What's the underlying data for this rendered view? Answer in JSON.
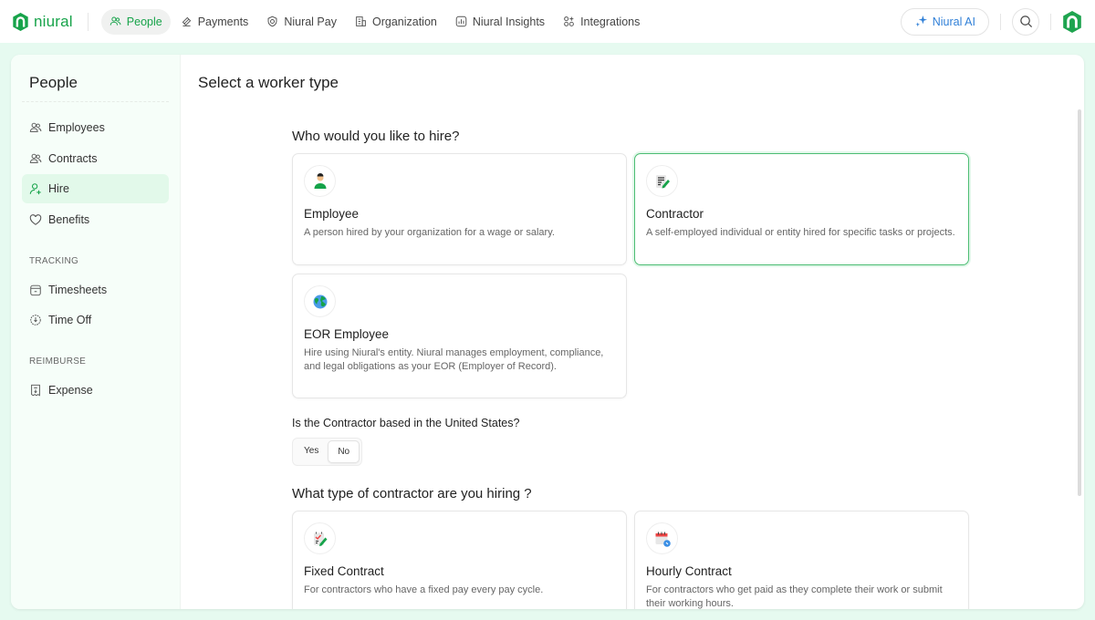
{
  "brand": {
    "name": "niural",
    "color": "#17a34a"
  },
  "nav": {
    "items": [
      {
        "label": "People",
        "icon": "users-icon",
        "active": true
      },
      {
        "label": "Payments",
        "icon": "payments-icon",
        "active": false
      },
      {
        "label": "Niural Pay",
        "icon": "shield-dollar-icon",
        "active": false
      },
      {
        "label": "Organization",
        "icon": "building-icon",
        "active": false
      },
      {
        "label": "Niural Insights",
        "icon": "chart-icon",
        "active": false
      },
      {
        "label": "Integrations",
        "icon": "apps-icon",
        "active": false
      }
    ],
    "ai_button": "Niural AI",
    "search_icon": "search-icon"
  },
  "sidebar": {
    "title": "People",
    "items": [
      {
        "label": "Employees",
        "icon": "users-icon",
        "active": false
      },
      {
        "label": "Contracts",
        "icon": "users-icon",
        "active": false
      },
      {
        "label": "Hire",
        "icon": "user-plus-icon",
        "active": true
      },
      {
        "label": "Benefits",
        "icon": "heart-icon",
        "active": false
      }
    ],
    "sections": [
      {
        "title": "TRACKING",
        "items": [
          {
            "label": "Timesheets",
            "icon": "calendar-icon"
          },
          {
            "label": "Time Off",
            "icon": "clock-icon"
          }
        ]
      },
      {
        "title": "REIMBURSE",
        "items": [
          {
            "label": "Expense",
            "icon": "receipt-icon"
          }
        ]
      }
    ]
  },
  "main": {
    "title": "Select a worker type",
    "question1": "Who would you like to hire?",
    "worker_types": [
      {
        "title": "Employee",
        "desc": "A person hired by your organization for a wage or salary.",
        "icon": "person-icon",
        "selected": false
      },
      {
        "title": "Contractor",
        "desc": "A self-employed individual or entity hired for specific tasks or projects.",
        "icon": "document-edit-icon",
        "selected": true
      },
      {
        "title": "EOR Employee",
        "desc": "Hire using Niural's entity. Niural manages employment, compliance, and legal obligations as your EOR (Employer of Record).",
        "icon": "globe-icon",
        "selected": false
      }
    ],
    "question2": "Is the Contractor based in the United States?",
    "toggle": {
      "options": [
        "Yes",
        "No"
      ],
      "selected": "No"
    },
    "question3": "What type of contractor are you hiring ?",
    "contract_types": [
      {
        "title": "Fixed Contract",
        "desc": "For contractors who have a fixed pay every pay cycle.",
        "icon": "checklist-edit-icon"
      },
      {
        "title": "Hourly Contract",
        "desc": "For contractors who get paid as they complete their work or submit their working hours.",
        "icon": "calendar-clock-icon"
      }
    ]
  }
}
